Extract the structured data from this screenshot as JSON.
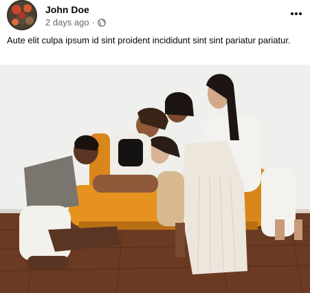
{
  "post": {
    "author": {
      "name": "John Doe"
    },
    "timestamp": "2 days ago",
    "separator": "·",
    "privacy_icon": "globe-icon",
    "more_icon": "more-horizontal-icon",
    "text": "Aute elit culpa ipsum id sint proident incididunt sint sint pariatur pariatur.",
    "photo_icon": "photo-image"
  },
  "colors": {
    "primary_text": "#050505",
    "secondary_text": "#65676b",
    "background": "#ffffff",
    "sofa": "#e5931e",
    "floor": "#6b3a22",
    "wall": "#efefed"
  }
}
